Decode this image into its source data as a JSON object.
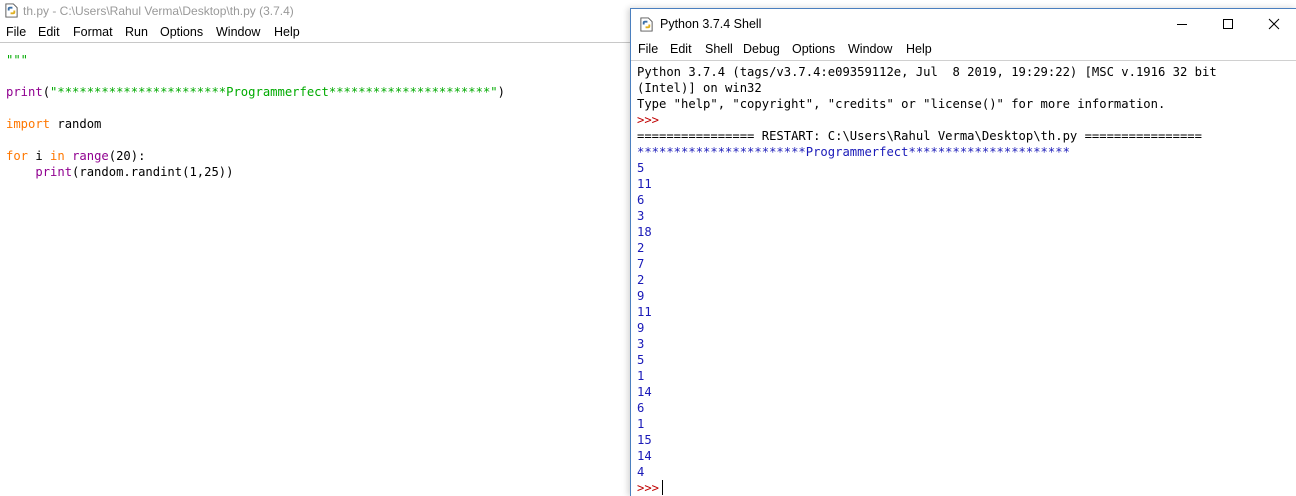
{
  "editor": {
    "title": "th.py - C:\\Users\\Rahul Verma\\Desktop\\th.py (3.7.4)",
    "menu": [
      "File",
      "Edit",
      "Format",
      "Run",
      "Options",
      "Window",
      "Help"
    ],
    "code": {
      "docstring": "\"\"\"",
      "print_kw": "print",
      "paren_open": "(",
      "banner_string": "\"***********************Programmerfect**********************\"",
      "paren_close": ")",
      "import_kw": "import",
      "import_rest": " random",
      "for_kw": "for",
      "for_var": " i ",
      "in_kw": "in",
      "space": " ",
      "range_bi": "range",
      "range_args": "(20):",
      "indent": "    ",
      "print2_kw": "print",
      "print2_args": "(random.randint(1,25))"
    }
  },
  "shell": {
    "title": "Python 3.7.4 Shell",
    "menu": [
      "File",
      "Edit",
      "Shell",
      "Debug",
      "Options",
      "Window",
      "Help"
    ],
    "header_line1": "Python 3.7.4 (tags/v3.7.4:e09359112e, Jul  8 2019, 19:29:22) [MSC v.1916 32 bit",
    "header_line2": "(Intel)] on win32",
    "header_line3": "Type \"help\", \"copyright\", \"credits\" or \"license()\" for more information.",
    "prompt": ">>>",
    "restart_line": "================ RESTART: C:\\Users\\Rahul Verma\\Desktop\\th.py ================",
    "banner_output": "***********************Programmerfect**********************",
    "outputs": [
      "5",
      "11",
      "6",
      "3",
      "18",
      "2",
      "7",
      "2",
      "9",
      "11",
      "9",
      "3",
      "5",
      "1",
      "14",
      "6",
      "1",
      "15",
      "14",
      "4"
    ],
    "final_prompt": ">>>"
  },
  "colors": {
    "keyword": "#ff7700",
    "builtin": "#900090",
    "string": "#00aa00",
    "stdout": "#1a1ab8",
    "prompt": "#c00000",
    "restart": "#0000ff"
  },
  "icons": [
    "python-file-icon",
    "python-shell-icon",
    "minimize-icon",
    "maximize-icon",
    "close-icon"
  ]
}
